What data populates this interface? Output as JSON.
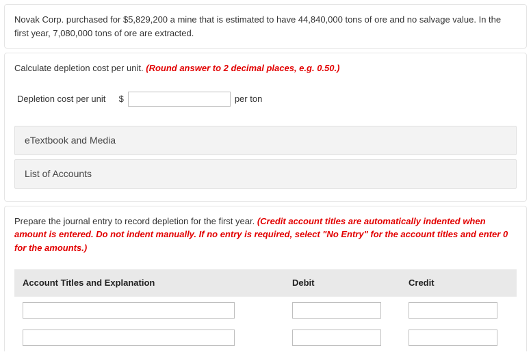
{
  "problem": {
    "text": "Novak Corp. purchased for $5,829,200 a mine that is estimated to have 44,840,000 tons of ore and no salvage value. In the first year, 7,080,000 tons of ore are extracted."
  },
  "part1": {
    "instruction_plain": "Calculate depletion cost per unit. ",
    "instruction_red": "(Round answer to 2 decimal places, e.g. 0.50.)",
    "label": "Depletion cost per unit",
    "currency": "$",
    "unit": "per ton",
    "value": "",
    "accordion1": "eTextbook and Media",
    "accordion2": "List of Accounts"
  },
  "part2": {
    "instruction_plain": "Prepare the journal entry to record depletion for the first year. ",
    "instruction_red": "(Credit account titles are automatically indented when amount is entered. Do not indent manually. If no entry is required, select \"No Entry\" for the account titles and enter 0 for the amounts.)",
    "headers": {
      "account": "Account Titles and Explanation",
      "debit": "Debit",
      "credit": "Credit"
    },
    "rows": [
      {
        "account": "",
        "debit": "",
        "credit": ""
      },
      {
        "account": "",
        "debit": "",
        "credit": ""
      }
    ]
  }
}
